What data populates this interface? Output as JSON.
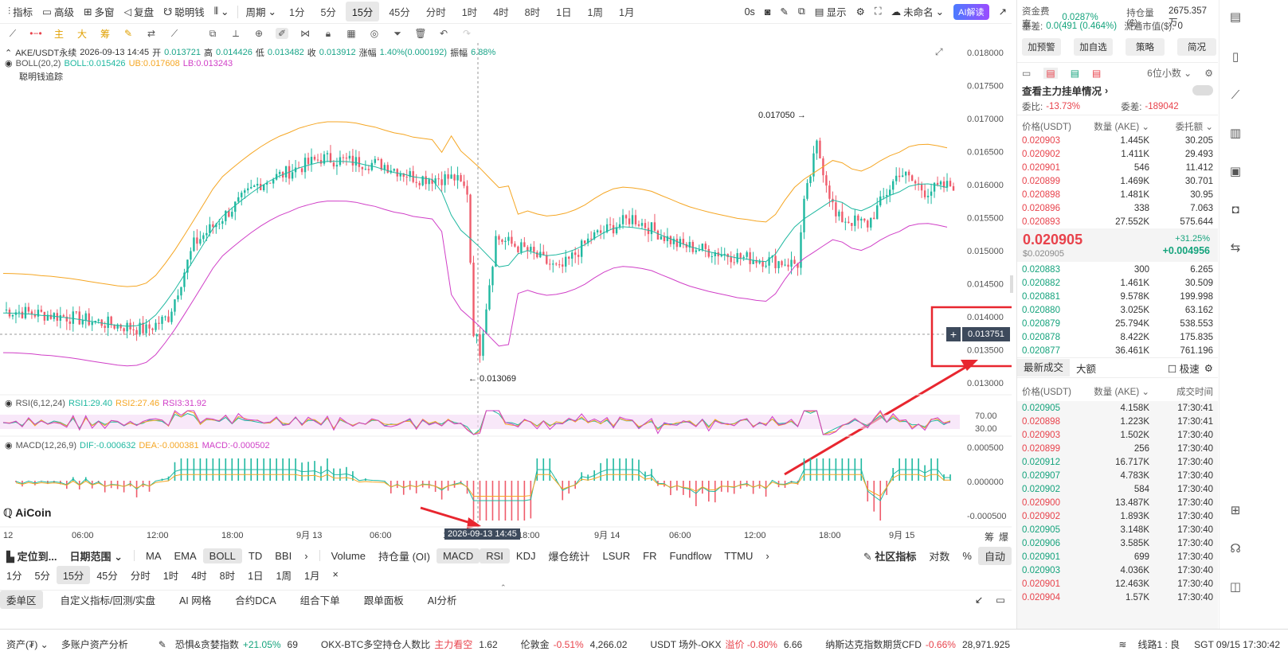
{
  "toolbar": {
    "indicators": "指标",
    "advanced": "高级",
    "multi_window": "多窗",
    "replay": "复盘",
    "smart_money": "聪明钱",
    "period_label": "周期",
    "periods": [
      "1分",
      "5分",
      "15分",
      "45分",
      "分时",
      "1时",
      "4时",
      "8时",
      "1日",
      "1周",
      "1月"
    ],
    "active_period": "15分",
    "fps": "0s",
    "display": "显示",
    "unnamed": "未命名",
    "ai": "AI解读"
  },
  "draw_tools": {
    "main": "主",
    "big": "大",
    "chip": "筹"
  },
  "chart": {
    "symbol": "AKE/USDT永续",
    "datetime": "2026-09-13 14:45",
    "open_label": "开",
    "open": "0.013721",
    "high_label": "高",
    "high": "0.014426",
    "low_label": "低",
    "low": "0.013482",
    "close_label": "收",
    "close": "0.013912",
    "change_label": "涨幅",
    "change": "1.40%(0.000192)",
    "amp_label": "振幅",
    "amp": "6.88%",
    "boll_label": "BOLL(20,2)",
    "boll": "BOLL:0.015426",
    "ub": "UB:0.017608",
    "lb": "LB:0.013243",
    "smart_track": "聪明钱追踪",
    "rsi_label": "RSI(6,12,24)",
    "rsi1": "RSI1:29.40",
    "rsi2": "RSI2:27.46",
    "rsi3": "RSI3:31.92",
    "macd_label": "MACD(12,26,9)",
    "dif": "DIF:-0.000632",
    "dea": "DEA:-0.000381",
    "macd": "MACD:-0.000502",
    "price_axis": [
      "0.018000",
      "0.017500",
      "0.017000",
      "0.016500",
      "0.016000",
      "0.015500",
      "0.015000",
      "0.014500",
      "0.014000",
      "0.013500",
      "0.013000"
    ],
    "crosshair_price": "0.013751",
    "high_marker": "0.017050",
    "low_marker": "0.013069",
    "rsi_axis": [
      "70.00",
      "30.00"
    ],
    "macd_axis": [
      "0.000500",
      "0.000000",
      "-0.000500"
    ],
    "time_axis": [
      "12",
      "06:00",
      "12:00",
      "18:00",
      "9月 13",
      "06:00",
      "12",
      "18:00",
      "9月 14",
      "06:00",
      "12:00",
      "18:00",
      "9月 15"
    ],
    "crosshair_time": "2026-09-13 14:45",
    "logo": "AiCoin",
    "chip": "筹",
    "burst": "爆"
  },
  "bottom": {
    "locate": "定位到...",
    "date_range": "日期范围",
    "indicators": [
      "MA",
      "EMA",
      "BOLL",
      "TD",
      "BBI",
      "Volume",
      "持仓量 (OI)",
      "MACD",
      "RSI",
      "KDJ",
      "爆仓统计",
      "LSUR",
      "FR",
      "Fundflow",
      "TTMU"
    ],
    "community": "社区指标",
    "log": "对数",
    "pct": "%",
    "auto": "自动",
    "periods": [
      "1分",
      "5分",
      "15分",
      "45分",
      "分时",
      "1时",
      "4时",
      "8时",
      "1日",
      "1周",
      "1月"
    ],
    "tabs": [
      "委单区",
      "自定义指标/回测/实盘",
      "AI 网格",
      "合约DCA",
      "组合下单",
      "跟单面板",
      "AI分析"
    ]
  },
  "status": {
    "assets": "资产(₮)",
    "multi": "多账户资产分析",
    "fear_label": "恐惧&贪婪指数",
    "fear_pct": "+21.05%",
    "fear_val": "69",
    "okx_label": "OKX-BTC多空持仓人数比",
    "okx_tag": "主力看空",
    "okx_val": "1.62",
    "gold_label": "伦敦金",
    "gold_pct": "-0.51%",
    "gold_val": "4,266.02",
    "usdt_label": "USDT 场外-OKX",
    "usdt_tag": "溢价 -0.80%",
    "usdt_val": "6.66",
    "nasdaq_label": "纳斯达克指数期货CFD",
    "nasdaq_pct": "-0.66%",
    "nasdaq_val": "28,971.925",
    "line": "线路1 : 良",
    "time": "SGT 09/15 17:30:42"
  },
  "panel": {
    "funding_label": "资金费率:",
    "funding": "0.0287%",
    "oi_label": "持仓量($):",
    "oi": "2675.357万",
    "basis_label": "基差:",
    "basis": "0.0(491 (0.464%)",
    "float_label": "流通市值($):",
    "float": "0",
    "btns": [
      "加预警",
      "加自选",
      "策略",
      "简况"
    ],
    "decimals": "6位小数",
    "main_orders": "查看主力挂单情况",
    "ratio_label": "委比:",
    "ratio": "-13.73%",
    "diff_label": "委差:",
    "diff": "-189042",
    "col_price": "价格(USDT)",
    "col_qty": "数量 (AKE)",
    "col_amount": "委托额",
    "asks": [
      [
        "0.020903",
        "1.445K",
        "30.205"
      ],
      [
        "0.020902",
        "1.411K",
        "29.493"
      ],
      [
        "0.020901",
        "546",
        "11.412"
      ],
      [
        "0.020899",
        "1.469K",
        "30.701"
      ],
      [
        "0.020898",
        "1.481K",
        "30.95"
      ],
      [
        "0.020896",
        "338",
        "7.063"
      ],
      [
        "0.020893",
        "27.552K",
        "575.644"
      ]
    ],
    "last_price": "0.020905",
    "last_usd": "$0.020905",
    "last_pct": "+31.25%",
    "last_chg": "+0.004956",
    "bids": [
      [
        "0.020883",
        "300",
        "6.265"
      ],
      [
        "0.020882",
        "1.461K",
        "30.509"
      ],
      [
        "0.020881",
        "9.578K",
        "199.998"
      ],
      [
        "0.020880",
        "3.025K",
        "63.162"
      ],
      [
        "0.020879",
        "25.794K",
        "538.553"
      ],
      [
        "0.020878",
        "8.422K",
        "175.835"
      ],
      [
        "0.020877",
        "36.461K",
        "761.196"
      ]
    ],
    "trades_tab": "最新成交",
    "big_tab": "大额",
    "fast": "极速",
    "col_time": "成交时间",
    "trades": [
      [
        "0.020905",
        "4.158K",
        "17:30:41",
        "g"
      ],
      [
        "0.020898",
        "1.223K",
        "17:30:41",
        "r"
      ],
      [
        "0.020903",
        "1.502K",
        "17:30:40",
        "r"
      ],
      [
        "0.020899",
        "256",
        "17:30:40",
        "r"
      ],
      [
        "0.020912",
        "16.717K",
        "17:30:40",
        "g"
      ],
      [
        "0.020907",
        "4.783K",
        "17:30:40",
        "g"
      ],
      [
        "0.020902",
        "584",
        "17:30:40",
        "g"
      ],
      [
        "0.020900",
        "13.487K",
        "17:30:40",
        "r"
      ],
      [
        "0.020902",
        "1.893K",
        "17:30:40",
        "r"
      ],
      [
        "0.020905",
        "3.148K",
        "17:30:40",
        "g"
      ],
      [
        "0.020906",
        "3.585K",
        "17:30:40",
        "g"
      ],
      [
        "0.020901",
        "699",
        "17:30:40",
        "g"
      ],
      [
        "0.020903",
        "4.036K",
        "17:30:40",
        "g"
      ],
      [
        "0.020901",
        "12.463K",
        "17:30:40",
        "r"
      ],
      [
        "0.020904",
        "1.57K",
        "17:30:40",
        "r"
      ]
    ]
  }
}
